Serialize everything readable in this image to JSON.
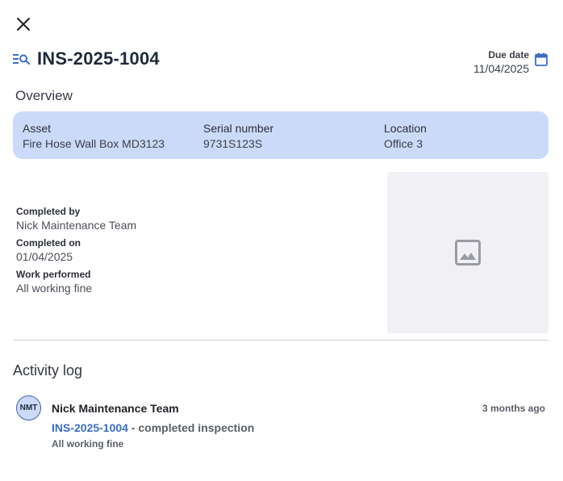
{
  "header": {
    "title": "INS-2025-1004",
    "due_label": "Due date",
    "due_value": "11/04/2025"
  },
  "overview": {
    "heading": "Overview",
    "asset_label": "Asset",
    "asset_value": "Fire Hose Wall Box MD3123",
    "serial_label": "Serial number",
    "serial_value": "9731S123S",
    "location_label": "Location",
    "location_value": "Office 3"
  },
  "details": {
    "completed_by_label": "Completed by",
    "completed_by_value": "Nick Maintenance Team",
    "completed_on_label": "Completed on",
    "completed_on_value": "01/04/2025",
    "work_label": "Work performed",
    "work_value": "All working fine"
  },
  "activity": {
    "heading": "Activity log",
    "entries": [
      {
        "initials": "NMT",
        "name": "Nick Maintenance Team",
        "time": "3 months ago",
        "ref": "INS-2025-1004",
        "action": " - completed inspection",
        "note": "All working fine"
      }
    ]
  },
  "icons": {
    "close": "close-icon",
    "title": "list-search-icon",
    "calendar": "calendar-icon",
    "image": "image-placeholder-icon"
  },
  "colors": {
    "accent": "#3a6cc8",
    "card_bg": "#ccdafa",
    "title": "#1f2a3a"
  }
}
